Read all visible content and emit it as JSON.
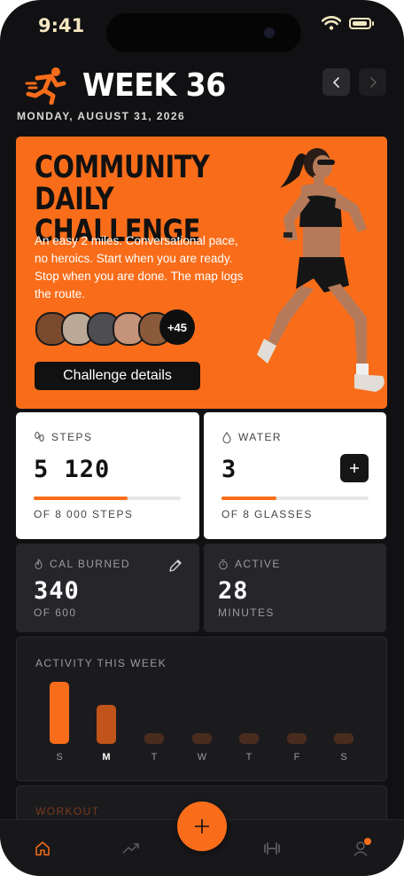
{
  "status_bar": {
    "time": "9:41"
  },
  "header": {
    "week": "WEEK 36",
    "date": "MONDAY, AUGUST 31, 2026",
    "prev_icon": "chevron-left-icon",
    "next_icon": "chevron-right-icon"
  },
  "challenge": {
    "title": "COMMUNITY\nDAILY CHALLENGE",
    "body": "An easy 2 miles. Conversational pace, no heroics. Start when you are ready. Stop when you are done. The map logs the route.",
    "participants_more": "+45",
    "button": "Challenge details",
    "accent": "#f96d1a"
  },
  "stats": {
    "steps": {
      "label": "STEPS",
      "value": "5 120",
      "goal": "OF 8 000 STEPS",
      "progress": 0.64
    },
    "water": {
      "label": "WATER",
      "value": "3",
      "goal": "OF 8 GLASSES",
      "progress": 0.375
    },
    "calories": {
      "label": "CAL BURNED",
      "value": "340",
      "goal": "OF 600"
    },
    "active": {
      "label": "ACTIVE",
      "value": "28",
      "unit": "MINUTES"
    }
  },
  "activity": {
    "title": "ACTIVITY THIS WEEK",
    "days": [
      "S",
      "M",
      "T",
      "W",
      "T",
      "F",
      "S"
    ],
    "levels": [
      1.0,
      0.63,
      0.0,
      0.0,
      0.0,
      0.0,
      0.0
    ],
    "current_day": "M"
  },
  "workout": {
    "title": "WORKOUT"
  },
  "tabbar": {
    "items": [
      "home-icon",
      "trend-icon",
      "add-icon",
      "dumbbell-icon",
      "profile-icon"
    ]
  }
}
